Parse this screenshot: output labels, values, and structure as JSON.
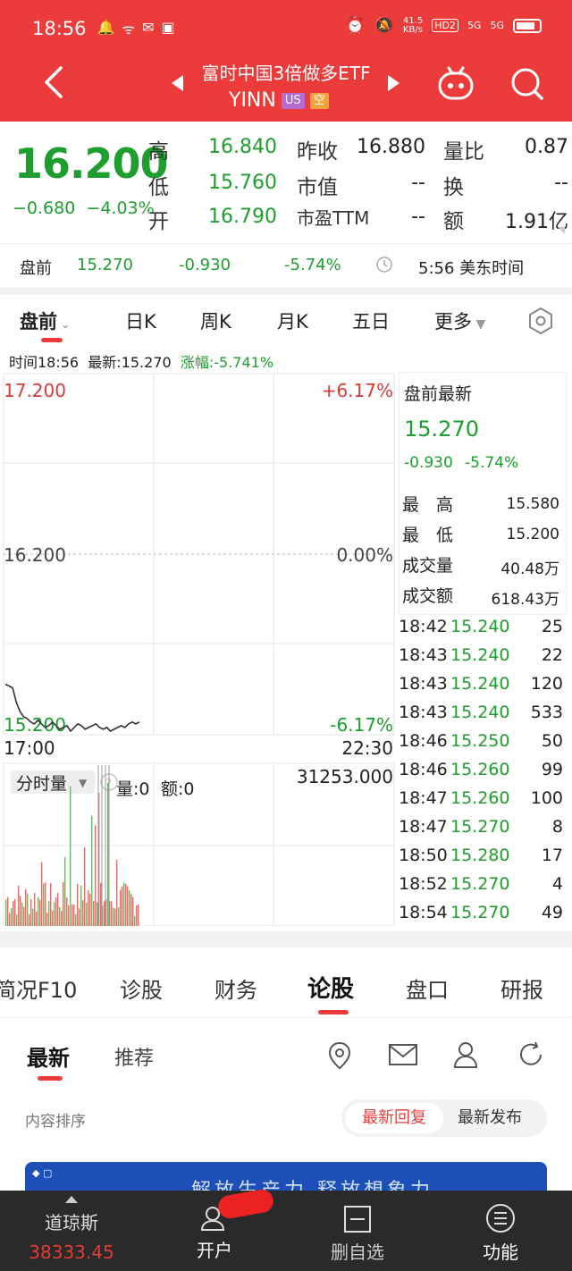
{
  "status": {
    "time": "18:56",
    "speed": "41.5\nKB/s",
    "net1": "5G",
    "net2": "5G",
    "hd": "HD2"
  },
  "header": {
    "title": "富时中国3倍做多ETF",
    "symbol": "YINN",
    "badge_us": "US",
    "badge_short": "空"
  },
  "quote": {
    "price": "16.200",
    "change": "−0.680",
    "change_pct": "−4.03%",
    "high_label": "高",
    "high": "16.840",
    "low_label": "低",
    "low": "15.760",
    "open_label": "开",
    "open": "16.790",
    "prev_close_label": "昨收",
    "prev_close": "16.880",
    "mcap_label": "市值",
    "mcap": "--",
    "pe_label": "市盈TTM",
    "pe": "--",
    "vol_ratio_label": "量比",
    "vol_ratio": "0.87",
    "turnover_label": "换",
    "turnover": "--",
    "amount_label": "额",
    "amount": "1.91亿"
  },
  "premarket": {
    "label": "盘前",
    "price": "15.270",
    "change": "-0.930",
    "pct": "-5.74%",
    "time": "5:56 美东时间"
  },
  "period_tabs": {
    "t0": "盘前",
    "t1": "日K",
    "t2": "周K",
    "t3": "月K",
    "t4": "五日",
    "t5": "更多"
  },
  "info_bar": {
    "time": "时间18:56",
    "latest": "最新:15.270",
    "rise": "涨幅:-5.741%"
  },
  "chart_data": {
    "type": "line",
    "title": "",
    "x_start": "17:00",
    "x_end": "22:30",
    "y_top": "17.200",
    "y_mid": "16.200",
    "y_bottom": "15.200",
    "pct_top": "+6.17%",
    "pct_mid": "0.00%",
    "pct_bottom": "-6.17%",
    "ylim": [
      15.2,
      17.2
    ],
    "series": [
      {
        "values": [
          15.48,
          15.47,
          15.46,
          15.38,
          15.33,
          15.3,
          15.29,
          15.27,
          15.26,
          15.28,
          15.26,
          15.24,
          15.25,
          15.27,
          15.25,
          15.23,
          15.24,
          15.25,
          15.22,
          15.24,
          15.26,
          15.25,
          15.23,
          15.24,
          15.25,
          15.26,
          15.24,
          15.23,
          15.24,
          15.22,
          15.23,
          15.24,
          15.25,
          15.24,
          15.26,
          15.27,
          15.26,
          15.27
        ]
      }
    ],
    "volume_label": "分时量",
    "volume_info": "量:0",
    "amount_info": "额:0",
    "volume_max": "31253.000"
  },
  "side_panel": {
    "title": "盘前最新",
    "price": "15.270",
    "change": "-0.930",
    "pct": "-5.74%",
    "high_label": "最　高",
    "high": "15.580",
    "low_label": "最　低",
    "low": "15.200",
    "vol_label": "成交量",
    "vol": "40.48万",
    "amt_label": "成交额",
    "amt": "618.43万",
    "ticks": [
      {
        "t": "18:42",
        "p": "15.240",
        "v": "25"
      },
      {
        "t": "18:43",
        "p": "15.240",
        "v": "22"
      },
      {
        "t": "18:43",
        "p": "15.240",
        "v": "120"
      },
      {
        "t": "18:43",
        "p": "15.240",
        "v": "533"
      },
      {
        "t": "18:46",
        "p": "15.250",
        "v": "50"
      },
      {
        "t": "18:46",
        "p": "15.260",
        "v": "99"
      },
      {
        "t": "18:47",
        "p": "15.260",
        "v": "100"
      },
      {
        "t": "18:47",
        "p": "15.270",
        "v": "8"
      },
      {
        "t": "18:50",
        "p": "15.280",
        "v": "17"
      },
      {
        "t": "18:52",
        "p": "15.270",
        "v": "4"
      },
      {
        "t": "18:54",
        "p": "15.270",
        "v": "49"
      }
    ]
  },
  "bottom_tabs": {
    "t0": "简况F10",
    "t1": "诊股",
    "t2": "财务",
    "t3": "论股",
    "t4": "盘口",
    "t5": "研报"
  },
  "sub_tabs": {
    "latest": "最新",
    "recommend": "推荐"
  },
  "sort": {
    "label": "内容排序",
    "opt1": "最新回复",
    "opt2": "最新发布"
  },
  "banner": {
    "text": "解放生产力 释放想象力"
  },
  "nav": {
    "dow_label": "道琼斯",
    "dow_value": "38333.45",
    "open_account": "开户",
    "remove_watch": "删自选",
    "functions": "功能"
  },
  "colors": {
    "red": "#ec3b3b",
    "green": "#1e9e2e"
  }
}
